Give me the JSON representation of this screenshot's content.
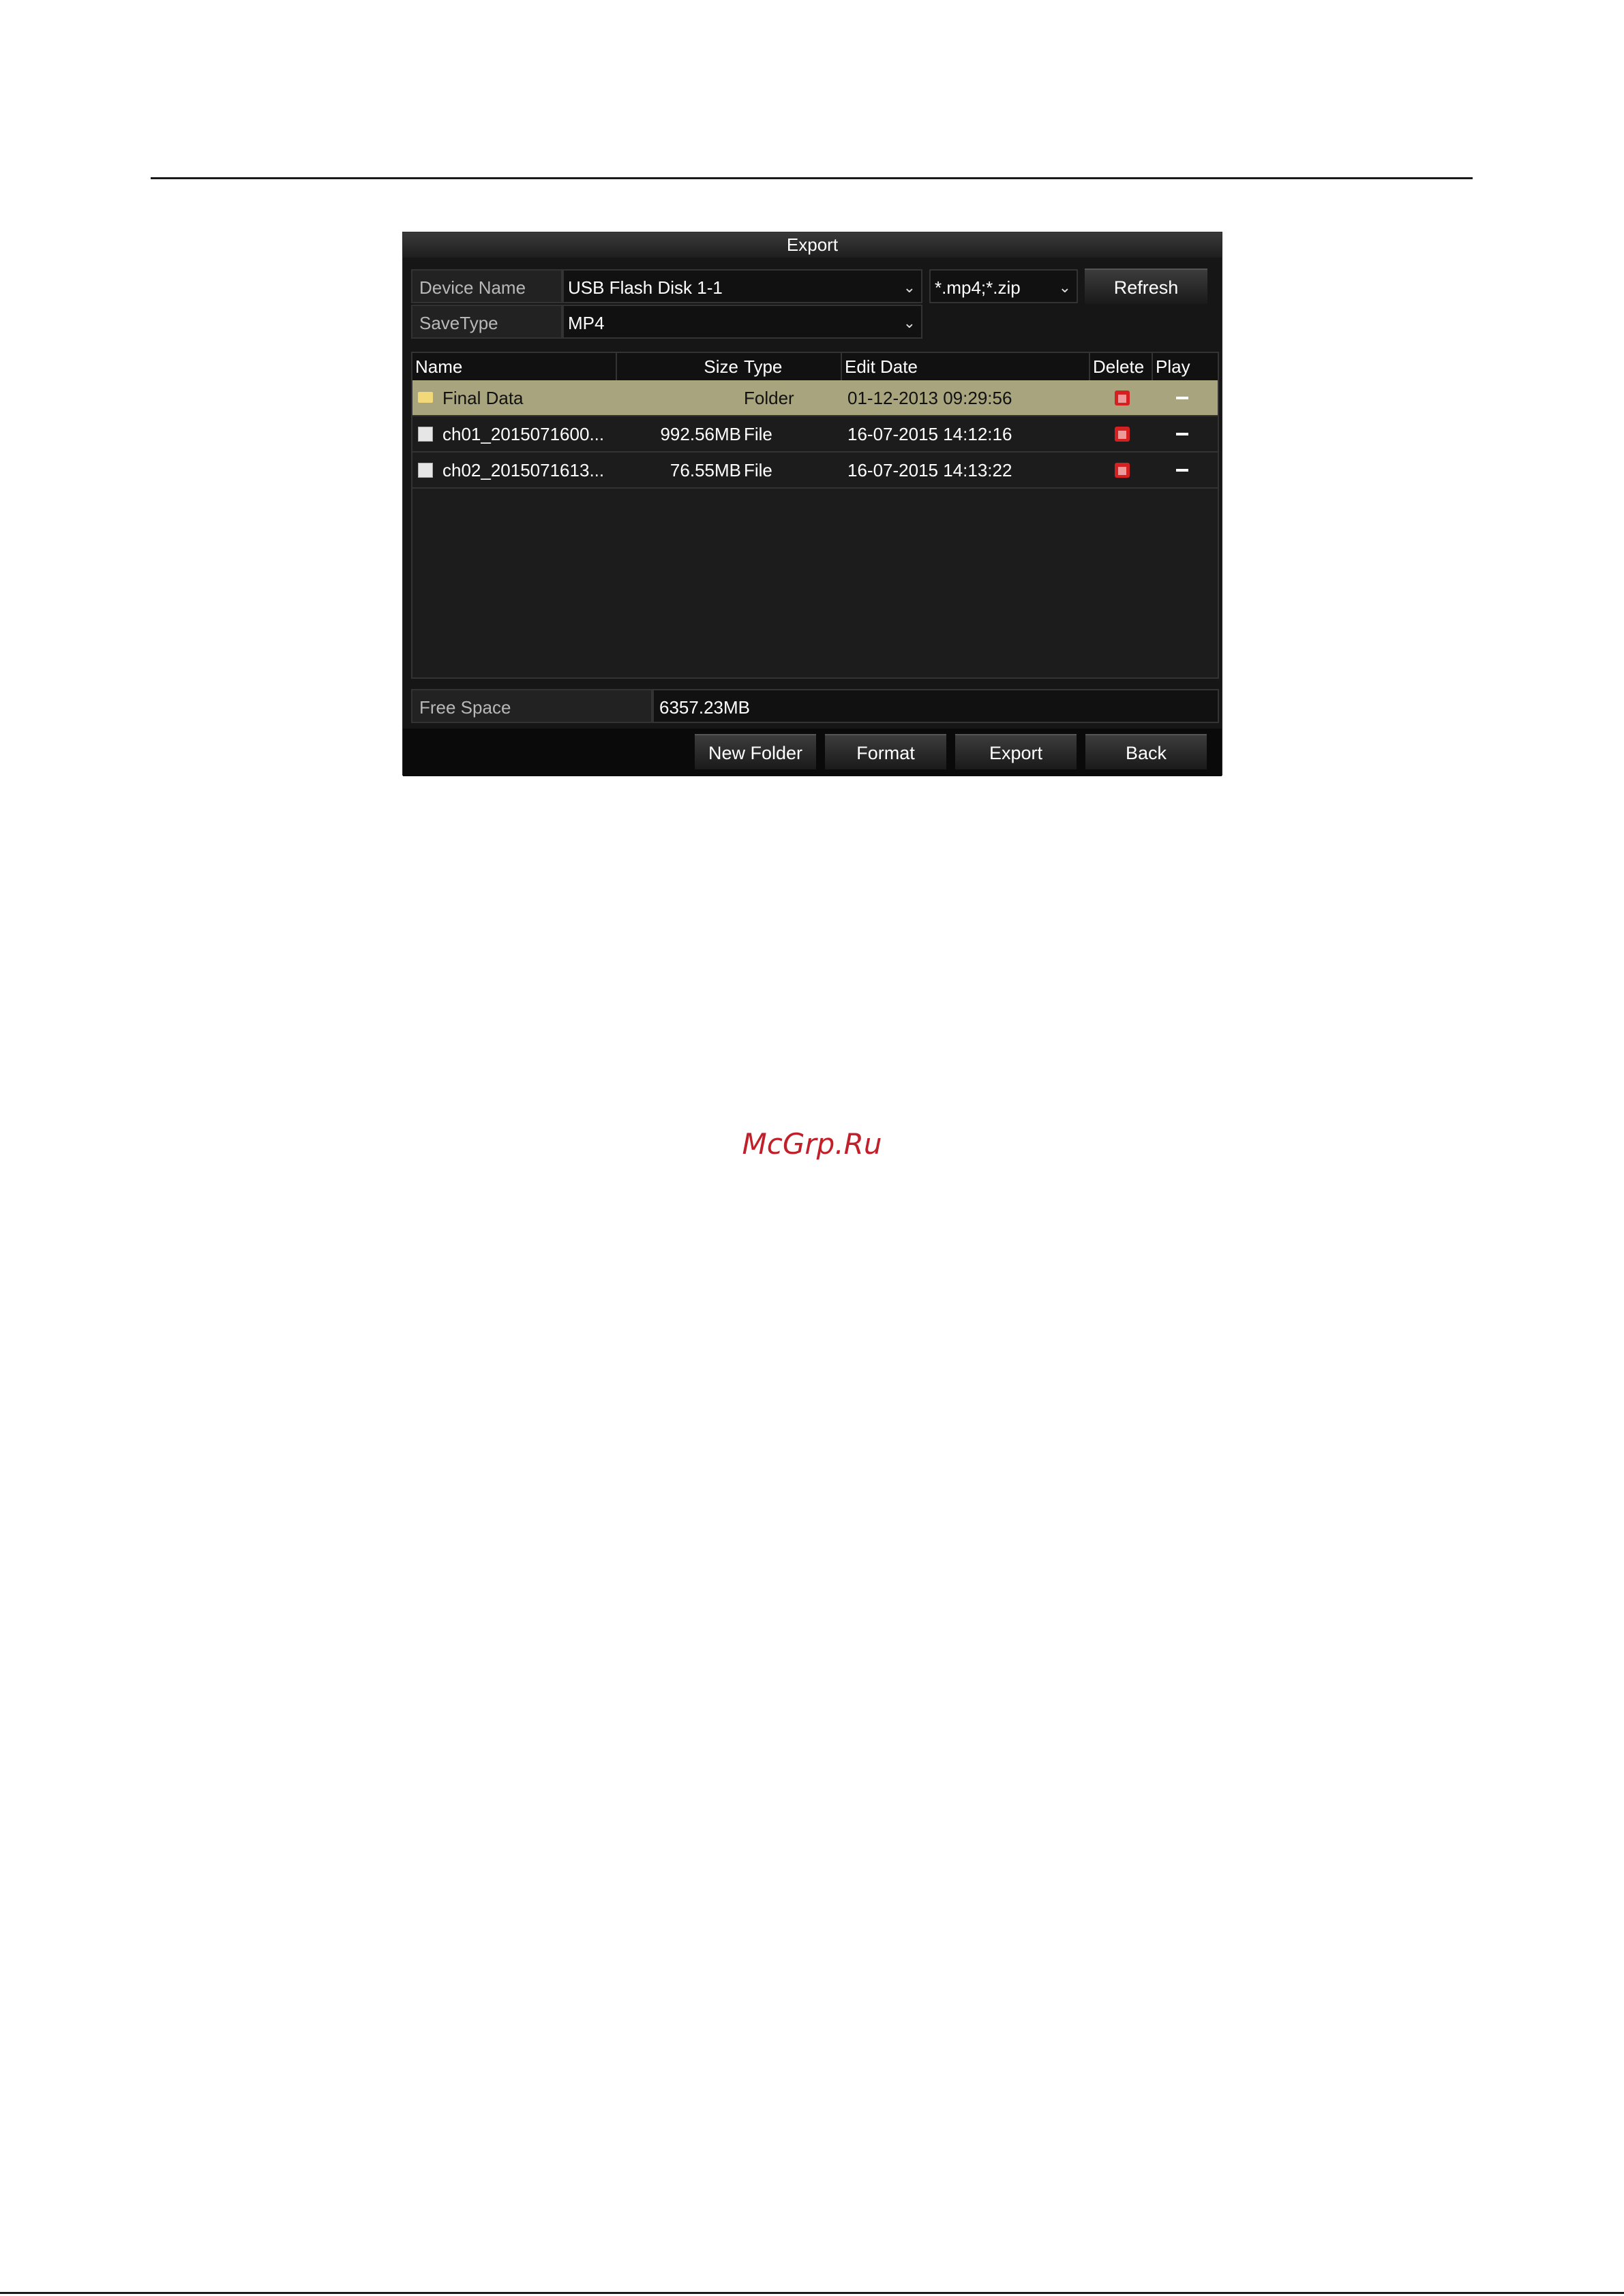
{
  "dialog": {
    "title": "Export",
    "device_name_label": "Device Name",
    "device_name_value": "USB Flash Disk 1-1",
    "filter_value": "*.mp4;*.zip",
    "refresh_label": "Refresh",
    "save_type_label": "SaveType",
    "save_type_value": "MP4"
  },
  "table": {
    "headers": {
      "name": "Name",
      "size": "Size",
      "type": "Type",
      "edit_date": "Edit Date",
      "delete": "Delete",
      "play": "Play"
    },
    "rows": [
      {
        "name": "Final Data",
        "size": "",
        "type": "Folder",
        "edit_date": "01-12-2013 09:29:56",
        "icon": "folder-icon",
        "selected": true
      },
      {
        "name": "ch01_2015071600...",
        "size": "992.56MB",
        "type": "File",
        "edit_date": "16-07-2015 14:12:16",
        "icon": "file-icon",
        "selected": false
      },
      {
        "name": "ch02_2015071613...",
        "size": "76.55MB",
        "type": "File",
        "edit_date": "16-07-2015 14:13:22",
        "icon": "file-icon",
        "selected": false
      }
    ]
  },
  "free_space": {
    "label": "Free Space",
    "value": "6357.23MB"
  },
  "buttons": {
    "new_folder": "New Folder",
    "format": "Format",
    "export": "Export",
    "back": "Back"
  },
  "watermark": "McGrp.Ru",
  "colors": {
    "selected_row": "#a8a57e",
    "delete_icon": "#d42020",
    "watermark": "#c0202a"
  }
}
